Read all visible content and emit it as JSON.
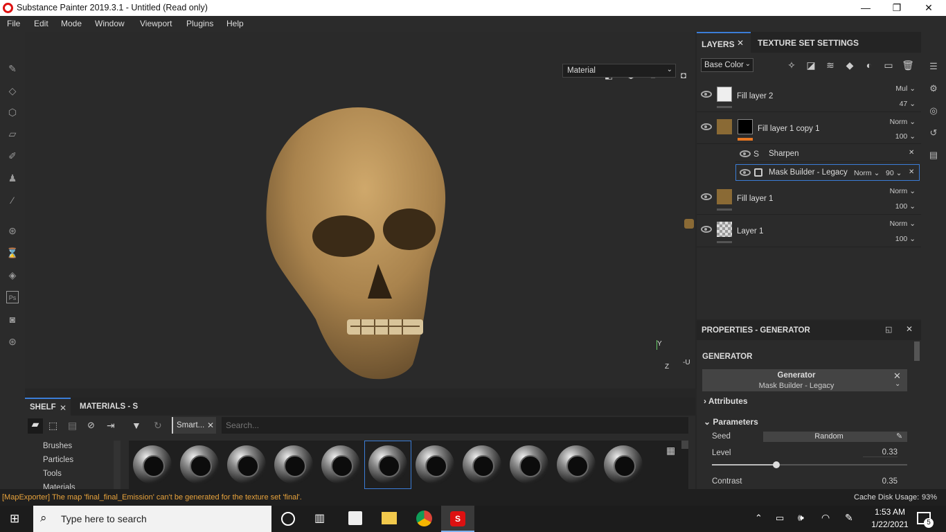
{
  "window": {
    "title": "Substance Painter 2019.3.1 - Untitled (Read only)",
    "minimize": "—",
    "maximize": "❐",
    "close": "✕"
  },
  "menu": [
    "File",
    "Edit",
    "Mode",
    "Window",
    "Viewport",
    "Plugins",
    "Help"
  ],
  "viewport": {
    "display_mode": "Material",
    "axis_y": "Y",
    "axis_z": "Z",
    "axis_u": "-U"
  },
  "layers_panel": {
    "tab_layers": "LAYERS",
    "tab_texture_set": "TEXTURE SET SETTINGS",
    "channel": "Base Color",
    "layers": [
      {
        "name": "Fill layer 2",
        "blend": "Mul",
        "opacity": "47"
      },
      {
        "name": "Fill layer 1 copy 1",
        "blend": "Norm",
        "opacity": "100"
      },
      {
        "name": "Fill layer 1",
        "blend": "Norm",
        "opacity": "100"
      },
      {
        "name": "Layer 1",
        "blend": "Norm",
        "opacity": "100"
      }
    ],
    "effects": [
      {
        "name": "Sharpen"
      },
      {
        "name": "Mask Builder - Legacy",
        "blend": "Norm",
        "opacity": "90"
      }
    ]
  },
  "properties": {
    "header": "PROPERTIES - GENERATOR",
    "section": "GENERATOR",
    "generator_label": "Generator",
    "generator_value": "Mask Builder - Legacy",
    "attributes": "Attributes",
    "parameters": "Parameters",
    "seed_label": "Seed",
    "seed_value": "Random",
    "level_label": "Level",
    "level_value": "0.33",
    "level_fraction": 0.33,
    "contrast_label": "Contrast",
    "contrast_value": "0.35"
  },
  "shelf": {
    "tab_shelf": "SHELF",
    "tab_materials": "MATERIALS - S",
    "filter_chip": "Smart...",
    "search_placeholder": "Search...",
    "categories": [
      "Brushes",
      "Particles",
      "Tools",
      "Materials"
    ]
  },
  "status": {
    "message": "[MapExporter] The map 'final_final_Emission' can't be generated for the texture set 'final'.",
    "cache": "Cache Disk Usage:",
    "cache_value": "93%"
  },
  "taskbar": {
    "search_placeholder": "Type here to search",
    "time": "1:53 AM",
    "date": "1/22/2021",
    "notifications": "5"
  },
  "colors": {
    "accent": "#e87722",
    "selection": "#3b7dd8",
    "skull": "#b08a55"
  }
}
